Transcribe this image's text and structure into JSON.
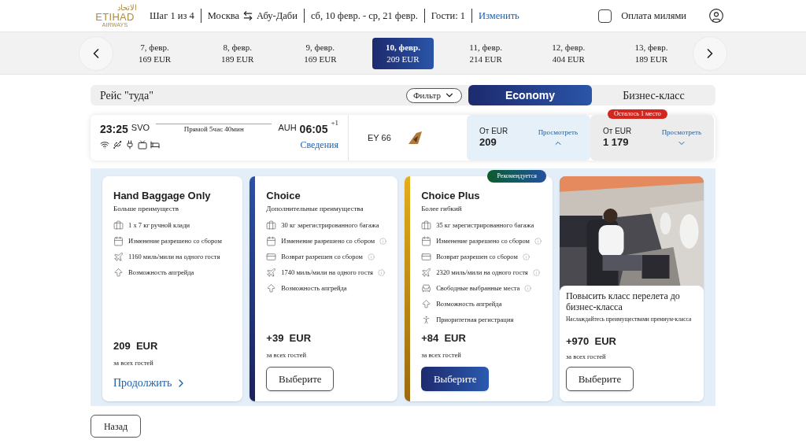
{
  "header": {
    "logo": {
      "arabic": "الاتحاد",
      "name": "ETIHAD",
      "sub": "AIRWAYS"
    },
    "step": "Шаг 1 из 4",
    "route_from": "Москва",
    "route_to": "Абу-Даби",
    "dates": "сб, 10 февр. - ср, 21 февр.",
    "guests": "Гости: 1",
    "change_link": "Изменить",
    "miles": {
      "label": "Оплата милями",
      "checked": false
    }
  },
  "date_strip": [
    {
      "date": "7, февр.",
      "price": "169  EUR",
      "selected": false
    },
    {
      "date": "8, февр.",
      "price": "189  EUR",
      "selected": false
    },
    {
      "date": "9, февр.",
      "price": "169  EUR",
      "selected": false
    },
    {
      "date": "10, февр.",
      "price": "209  EUR",
      "selected": true
    },
    {
      "date": "11, февр.",
      "price": "214  EUR",
      "selected": false
    },
    {
      "date": "12, февр.",
      "price": "404  EUR",
      "selected": false
    },
    {
      "date": "13, февр.",
      "price": "189  EUR",
      "selected": false
    }
  ],
  "outbound": {
    "title": "Рейс \"туда\"",
    "filter": "Фильтр",
    "cabins": [
      {
        "label": "Economy",
        "selected": true
      },
      {
        "label": "Бизнес-класс",
        "selected": false
      }
    ]
  },
  "flight": {
    "dep_time": "23:25",
    "dep_code": "SVO",
    "duration": "Прямой 5час 40мин",
    "arr_code": "AUH",
    "arr_time": "06:05",
    "day_offset": "+1",
    "details_link": "Сведения",
    "number": "EY 66",
    "fares": [
      {
        "from": "От EUR",
        "amount": "209",
        "view": "Просмотреть",
        "expanded": true
      },
      {
        "badge": "Осталось 1 место",
        "from": "От EUR",
        "amount": "1 179",
        "view": "Просмотреть",
        "expanded": false
      }
    ]
  },
  "fare_options": [
    {
      "kind": "plain",
      "title": "Hand Baggage Only",
      "subtitle": "Больше преимуществ",
      "features": [
        {
          "kind": "bag",
          "text": "1 x 7 кг ручной клади",
          "info": false
        },
        {
          "kind": "calendar",
          "text": "Изменение разрешено со сбором",
          "info": false
        },
        {
          "kind": "miles",
          "text": "1160 миль/мили на одного гостя",
          "info": false
        },
        {
          "kind": "upgrade",
          "text": "Возможность апгрейда",
          "info": false
        }
      ],
      "price": "209  EUR",
      "note": "за всех гостей",
      "action": {
        "kind": "link",
        "label": "Продолжить"
      }
    },
    {
      "kind": "blue",
      "title": "Choice",
      "subtitle": "Дополнительные преимущества",
      "features": [
        {
          "kind": "bag",
          "text": "30 кг зарегистрированного багажа",
          "info": false
        },
        {
          "kind": "calendar",
          "text": "Изменение разрешено со сбором",
          "info": true
        },
        {
          "kind": "refund",
          "text": "Возврат разрешен со сбором",
          "info": true
        },
        {
          "kind": "miles",
          "text": "1740 миль/мили на одного гостя",
          "info": true
        },
        {
          "kind": "upgrade",
          "text": "Возможность апгрейда",
          "info": false
        }
      ],
      "price": "+39  EUR",
      "note": "за всех гостей",
      "action": {
        "kind": "outline",
        "label": "Выберите"
      }
    },
    {
      "kind": "gold",
      "badge": "Рекомендуется",
      "title": "Choice Plus",
      "subtitle": "Более гибкий",
      "features": [
        {
          "kind": "bag",
          "text": "35 кг зарегистрированного багажа",
          "info": false
        },
        {
          "kind": "calendar",
          "text": "Изменение разрешено со сбором",
          "info": true
        },
        {
          "kind": "refund",
          "text": "Возврат разрешен со сбором",
          "info": true
        },
        {
          "kind": "miles",
          "text": "2320 миль/мили на одного гостя",
          "info": true
        },
        {
          "kind": "seat",
          "text": "Свободные выбранные места",
          "info": true
        },
        {
          "kind": "upgrade",
          "text": "Возможность апгрейда",
          "info": false
        },
        {
          "kind": "priority",
          "text": "Приоритетная регистрация",
          "info": false
        }
      ],
      "price": "+84  EUR",
      "note": "за всех гостей",
      "action": {
        "kind": "filled",
        "label": "Выберите"
      }
    }
  ],
  "upgrade": {
    "kind": "picture",
    "title": "Повысить класс перелета до бизнес-класса",
    "subtitle": "Наслаждайтесь преимуществами премиум-класса",
    "price": "+970  EUR",
    "note": "за всех гостей",
    "action": {
      "kind": "outline",
      "label": "Выберите"
    }
  },
  "back_button": "Назад"
}
